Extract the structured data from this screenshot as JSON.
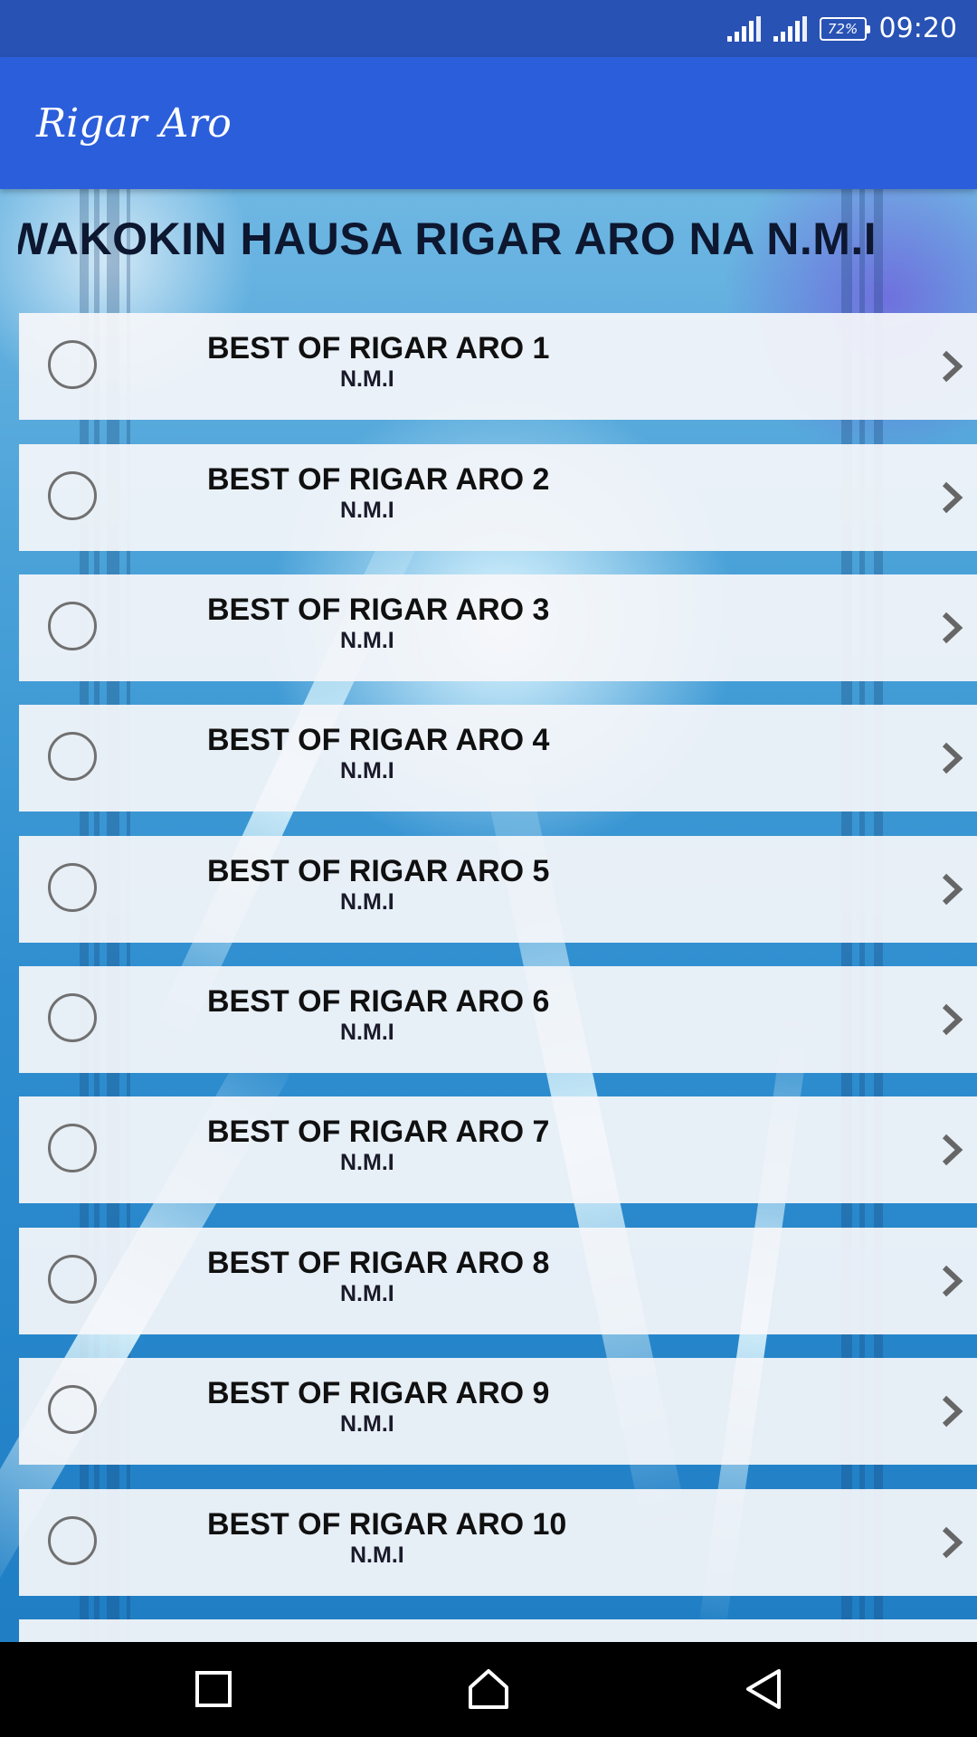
{
  "status_bar": {
    "battery": "72%",
    "time": "09:20"
  },
  "app_bar": {
    "title": "Rigar Aro"
  },
  "heading": {
    "text": "WAKOKIN HAUSA RIGAR ARO NA N.M.I"
  },
  "list": {
    "items": [
      {
        "title": "BEST OF RIGAR ARO 1",
        "subtitle": "N.M.I"
      },
      {
        "title": "BEST OF RIGAR ARO 2",
        "subtitle": "N.M.I"
      },
      {
        "title": "BEST OF RIGAR ARO 3",
        "subtitle": "N.M.I"
      },
      {
        "title": "BEST OF RIGAR ARO 4",
        "subtitle": "N.M.I"
      },
      {
        "title": "BEST OF RIGAR ARO 5",
        "subtitle": "N.M.I"
      },
      {
        "title": "BEST OF RIGAR ARO 6",
        "subtitle": "N.M.I"
      },
      {
        "title": "BEST OF RIGAR ARO 7",
        "subtitle": "N.M.I"
      },
      {
        "title": "BEST OF RIGAR ARO 8",
        "subtitle": "N.M.I"
      },
      {
        "title": "BEST OF RIGAR ARO 9",
        "subtitle": "N.M.I"
      },
      {
        "title": "BEST OF RIGAR ARO 10",
        "subtitle": "N.M.I"
      }
    ]
  },
  "icons": {
    "status": [
      "signal-icon",
      "signal-icon",
      "battery-icon"
    ],
    "list_item": [
      "radio-button-icon",
      "chevron-right-icon"
    ],
    "nav": [
      "recents-square-icon",
      "home-icon",
      "back-triangle-icon"
    ]
  },
  "colors": {
    "status_bar": "#2852b4",
    "app_bar": "#2b5edb",
    "heading_text": "#0d1730",
    "nav_bar": "#000000"
  }
}
